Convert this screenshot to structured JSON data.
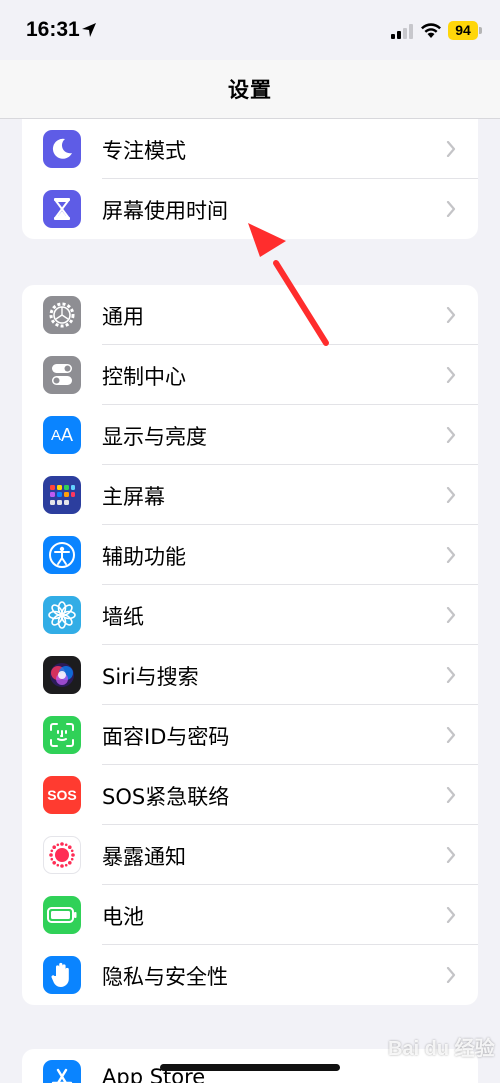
{
  "status_bar": {
    "time": "16:31",
    "battery": "94"
  },
  "nav": {
    "title": "设置"
  },
  "group1": [
    {
      "label": "专注模式",
      "icon": "moon-icon",
      "color": "#5e5ce6"
    },
    {
      "label": "屏幕使用时间",
      "icon": "hourglass-icon",
      "color": "#5e5ce6"
    }
  ],
  "group2": [
    {
      "label": "通用",
      "icon": "gear-icon",
      "color": "#8e8e93"
    },
    {
      "label": "控制中心",
      "icon": "toggles-icon",
      "color": "#8e8e93"
    },
    {
      "label": "显示与亮度",
      "icon": "text-size-icon",
      "color": "#0a84ff"
    },
    {
      "label": "主屏幕",
      "icon": "app-grid-icon",
      "color": "#2c3e9e"
    },
    {
      "label": "辅助功能",
      "icon": "accessibility-icon",
      "color": "#0a84ff"
    },
    {
      "label": "墙纸",
      "icon": "flower-icon",
      "color": "#32ade6"
    },
    {
      "label": "Siri与搜索",
      "icon": "siri-icon",
      "color": "#1c1c1e"
    },
    {
      "label": "面容ID与密码",
      "icon": "face-id-icon",
      "color": "#30d158"
    },
    {
      "label": "SOS紧急联络",
      "icon": "sos-icon",
      "color": "#ff3b30",
      "icon_text": "SOS"
    },
    {
      "label": "暴露通知",
      "icon": "exposure-icon",
      "color": "#ffffff"
    },
    {
      "label": "电池",
      "icon": "battery-icon",
      "color": "#30d158"
    },
    {
      "label": "隐私与安全性",
      "icon": "hand-icon",
      "color": "#0a84ff"
    }
  ],
  "group3": [
    {
      "label": "App Store",
      "icon": "app-store-icon",
      "color": "#0a84ff"
    }
  ],
  "watermark": "Bai du 经验",
  "accent": "#ff2d2d"
}
